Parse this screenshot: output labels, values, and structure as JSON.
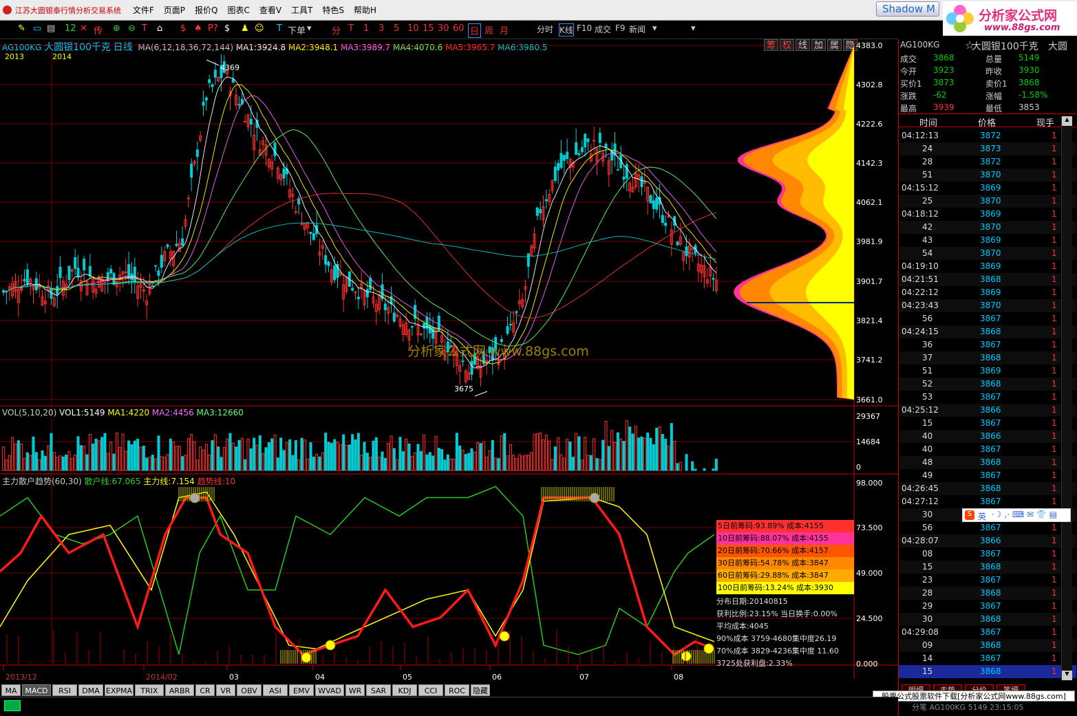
{
  "app": {
    "title": "江苏大圆银泰行情分析交易系统",
    "menus": [
      "文件F",
      "页面P",
      "报价Q",
      "图表C",
      "查看V",
      "工具T",
      "特色S",
      "帮助H"
    ],
    "shadow_btn": "Shadow M",
    "logo_text": "分析家公式网",
    "logo_url": "www.88gs.com"
  },
  "toolbar": {
    "xiadan": "下单",
    "periods": [
      "分",
      "T",
      "1",
      "3",
      "5",
      "10",
      "15",
      "30",
      "60",
      "日",
      "周",
      "月"
    ],
    "right": [
      "分时",
      "K线",
      "F10",
      "成交",
      "F9",
      "新闻"
    ],
    "num": "12"
  },
  "chart": {
    "header": {
      "symbol": "AG100KG",
      "name": "大圆银100千克",
      "period": "日线",
      "ma_params": "MA(6,12,18,36,72,144)",
      "ma1": "MA1:3924.8",
      "ma2": "MA2:3948.1",
      "ma3": "MA3:3989.7",
      "ma4": "MA4:4070.6",
      "ma5": "MA5:3965.7",
      "ma6": "MA6:3980.5"
    },
    "year_labels": [
      "2013",
      "2014"
    ],
    "high_label": "4369",
    "low_label": "3675",
    "right_tabs": [
      "筹",
      "权",
      "线",
      "加",
      "属",
      "隐"
    ],
    "price_axis": [
      "4383.0",
      "4302.8",
      "4222.6",
      "4142.3",
      "4062.1",
      "3981.9",
      "3901.7",
      "3821.4",
      "3741.2",
      "3661.0"
    ],
    "watermark": "分析家公式网 www.88gs.com",
    "colors": {
      "ma1": "#ffffff",
      "ma2": "#ffff00",
      "ma3": "#ff66ff",
      "ma4": "#66ff66",
      "ma5": "#ff3030",
      "ma6": "#00cccc"
    }
  },
  "volume": {
    "header": {
      "label": "VOL(5,10,20)",
      "vol1": "VOL1:5149",
      "ma1": "MA1:4220",
      "ma2": "MA2:4456",
      "ma3": "MA3:12660"
    },
    "axis": [
      "29367",
      "14684",
      "0"
    ]
  },
  "indicator": {
    "header": {
      "label": "主力散户趋势(60,30)",
      "retail": "散户线:67.065",
      "main": "主力线:7.154",
      "trend": "趋势线:10"
    },
    "axis": [
      "98.000",
      "73.500",
      "49.000",
      "24.500",
      "0.000"
    ]
  },
  "chips": [
    {
      "text": "5日前筹码:93.89%   成本:4155",
      "color": "#ff3030"
    },
    {
      "text": "10日前筹码:88.07%  成本:4155",
      "color": "#ff3399"
    },
    {
      "text": "20日前筹码:70.66%  成本:4157",
      "color": "#ff5500"
    },
    {
      "text": "30日前筹码:54.78%  成本:3847",
      "color": "#ff8800"
    },
    {
      "text": "60日前筹码:29.88%  成本:3847",
      "color": "#ffaa00"
    },
    {
      "text": "100日前筹码:13.24%  成本:3930",
      "color": "#ffff00"
    }
  ],
  "chip_stats": [
    "分布日期:20140815",
    "获利比例:23.15%   当日换手:0.00%",
    "平均成本:4045",
    "90%成本 3759-4680集中度26.19",
    "70%成本 3829-4236集中度 11.60",
    "3725处获利盘:2.33%"
  ],
  "xaxis": [
    "2013/12",
    "2014/02",
    "03",
    "04",
    "05",
    "06",
    "07",
    "08"
  ],
  "bottom_tabs": [
    "MA",
    "MACD",
    "RSI",
    "DMA",
    "EXPMA",
    "TRIX",
    "ARBR",
    "CR",
    "VR",
    "OBV",
    "ASI",
    "EMV",
    "WVAD",
    "WR",
    "SAR",
    "KDJ",
    "CCI",
    "ROC",
    "隐藏"
  ],
  "quote": {
    "symbol": "AG100KG",
    "name": "大圆银100千克",
    "name2": "大圆",
    "fields": [
      [
        "成交",
        "3868",
        "总量",
        "5149"
      ],
      [
        "今开",
        "3923",
        "昨收",
        "3930"
      ],
      [
        "买价1",
        "3873",
        "卖价1",
        "3868"
      ],
      [
        "涨跌",
        "-62",
        "涨幅",
        "-1.58%"
      ],
      [
        "最高",
        "3939",
        "最低",
        "3853"
      ]
    ]
  },
  "ticks_header": [
    "时间",
    "价格",
    "现手"
  ],
  "ticks": [
    [
      "04:12:13",
      "3872",
      "1"
    ],
    [
      "24",
      "3873",
      "1"
    ],
    [
      "28",
      "3872",
      "1"
    ],
    [
      "51",
      "3870",
      "1"
    ],
    [
      "04:15:12",
      "3869",
      "1"
    ],
    [
      "25",
      "3870",
      "1"
    ],
    [
      "04:18:12",
      "3869",
      "1"
    ],
    [
      "42",
      "3870",
      "1"
    ],
    [
      "43",
      "3869",
      "1"
    ],
    [
      "54",
      "3870",
      "1"
    ],
    [
      "04:19:10",
      "3869",
      "1"
    ],
    [
      "04:21:51",
      "3868",
      "1"
    ],
    [
      "04:22:12",
      "3869",
      "1"
    ],
    [
      "04:23:43",
      "3870",
      "1"
    ],
    [
      "56",
      "3867",
      "1"
    ],
    [
      "04:24:15",
      "3868",
      "1"
    ],
    [
      "36",
      "3867",
      "1"
    ],
    [
      "37",
      "3868",
      "1"
    ],
    [
      "51",
      "3869",
      "1"
    ],
    [
      "52",
      "3868",
      "1"
    ],
    [
      "53",
      "3867",
      "1"
    ],
    [
      "04:25:12",
      "3866",
      "1"
    ],
    [
      "15",
      "3867",
      "1"
    ],
    [
      "40",
      "3866",
      "1"
    ],
    [
      "40",
      "3867",
      "1"
    ],
    [
      "48",
      "3868",
      "1"
    ],
    [
      "49",
      "3867",
      "1"
    ],
    [
      "04:26:45",
      "3868",
      "1"
    ],
    [
      "04:27:12",
      "3867",
      "1"
    ],
    [
      "30",
      "3866",
      "1"
    ],
    [
      "56",
      "3867",
      "1"
    ],
    [
      "04:28:07",
      "3866",
      "1"
    ],
    [
      "08",
      "3867",
      "1"
    ],
    [
      "15",
      "3868",
      "1"
    ],
    [
      "23",
      "3867",
      "1"
    ],
    [
      "28",
      "3868",
      "1"
    ],
    [
      "29",
      "3867",
      "1"
    ],
    [
      "30",
      "3868",
      "1"
    ],
    [
      "04:29:08",
      "3867",
      "1"
    ],
    [
      "09",
      "3868",
      "1"
    ],
    [
      "14",
      "3867",
      "1"
    ],
    [
      "15",
      "3868",
      "1"
    ]
  ],
  "ime": "英",
  "bottom_right_tabs": [
    "明细",
    "走势",
    "分价",
    "笔细"
  ],
  "footer": "股票公式股票软件下载[分析家公式网www.88gs.com]",
  "footer2": "分笔 AG100KG 5149    23:15:05"
}
